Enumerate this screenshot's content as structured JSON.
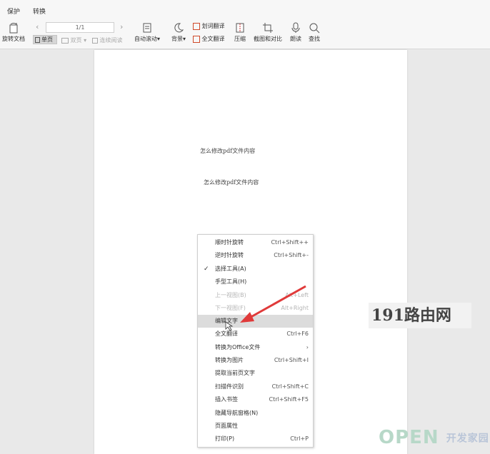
{
  "menu_tabs": [
    "保护",
    "转换"
  ],
  "toolbar": {
    "rotate_doc": "旋转文档",
    "page_indicator": "1/1",
    "single_page": "单页",
    "double_page": "双页",
    "continuous": "连续阅读",
    "auto_scroll": "自动滚动",
    "background": "背景",
    "word_translate": "划词翻译",
    "full_translate": "全文翻译",
    "compress": "压缩",
    "screenshot_compare": "截图和对比",
    "read_aloud": "朗读",
    "search": "查找",
    "dropdown_marker": "▾"
  },
  "document": {
    "line1": "怎么修改pdf文件内容",
    "line2": "怎么修改pdf文件内容"
  },
  "context_menu": [
    {
      "label": "顺时针旋转",
      "shortcut": "Ctrl+Shift++",
      "disabled": false,
      "checked": false,
      "highlighted": false
    },
    {
      "label": "逆时针旋转",
      "shortcut": "Ctrl+Shift+-",
      "disabled": false,
      "checked": false,
      "highlighted": false
    },
    {
      "label": "选择工具(A)",
      "shortcut": "",
      "disabled": false,
      "checked": true,
      "highlighted": false
    },
    {
      "label": "手型工具(H)",
      "shortcut": "",
      "disabled": false,
      "checked": false,
      "highlighted": false
    },
    {
      "label": "上一视图(B)",
      "shortcut": "Alt+Left",
      "disabled": true,
      "checked": false,
      "highlighted": false
    },
    {
      "label": "下一视图(F)",
      "shortcut": "Alt+Right",
      "disabled": true,
      "checked": false,
      "highlighted": false
    },
    {
      "label": "编辑文字",
      "shortcut": "",
      "disabled": false,
      "checked": false,
      "highlighted": true
    },
    {
      "label": "全文翻译",
      "shortcut": "Ctrl+F6",
      "disabled": false,
      "checked": false,
      "highlighted": false
    },
    {
      "label": "转换为Office文件",
      "shortcut": "›",
      "disabled": false,
      "checked": false,
      "highlighted": false
    },
    {
      "label": "转换为图片",
      "shortcut": "Ctrl+Shift+I",
      "disabled": false,
      "checked": false,
      "highlighted": false
    },
    {
      "label": "提取当前页文字",
      "shortcut": "",
      "disabled": false,
      "checked": false,
      "highlighted": false
    },
    {
      "label": "扫描件识别",
      "shortcut": "Ctrl+Shift+C",
      "disabled": false,
      "checked": false,
      "highlighted": false
    },
    {
      "label": "插入书签",
      "shortcut": "Ctrl+Shift+F5",
      "disabled": false,
      "checked": false,
      "highlighted": false
    },
    {
      "label": "隐藏导航窗格(N)",
      "shortcut": "",
      "disabled": false,
      "checked": false,
      "highlighted": false
    },
    {
      "label": "页面属性",
      "shortcut": "",
      "disabled": false,
      "checked": false,
      "highlighted": false
    },
    {
      "label": "打印(P)",
      "shortcut": "Ctrl+P",
      "disabled": false,
      "checked": false,
      "highlighted": false
    }
  ],
  "watermarks": {
    "site_191": "191路由网",
    "open_logo": "OPEN",
    "open_cn": "开发家园"
  },
  "colors": {
    "arrow": "#e03a3a",
    "menu_highlight": "#dcdcdc"
  }
}
